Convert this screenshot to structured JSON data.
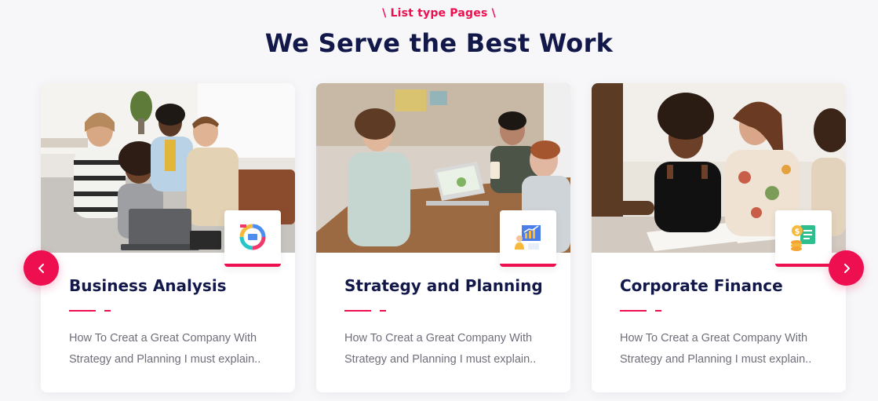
{
  "section": {
    "eyebrow": "\\ List type Pages \\",
    "title": "We Serve the Best Work"
  },
  "colors": {
    "accent": "#ed0f4f",
    "heading": "#13184b",
    "body_text": "#6e6f7a",
    "background": "#f7f7f9"
  },
  "carousel": {
    "prev_icon": "chevron-left-icon",
    "next_icon": "chevron-right-icon"
  },
  "cards": [
    {
      "title": "Business Analysis",
      "text": "How To Creat a Great Company With Strategy and Planning I must explain..",
      "photo": "team-around-laptop-photo",
      "icon": "analysis-cycle-icon"
    },
    {
      "title": "Strategy and Planning",
      "text": "How To Creat a Great Company With Strategy and Planning I must explain..",
      "photo": "meeting-at-desk-photo",
      "icon": "growth-chart-presenter-icon"
    },
    {
      "title": "Corporate Finance",
      "text": "How To Creat a Great Company With Strategy and Planning I must explain..",
      "photo": "group-signing-documents-photo",
      "icon": "finance-coins-document-icon"
    }
  ]
}
